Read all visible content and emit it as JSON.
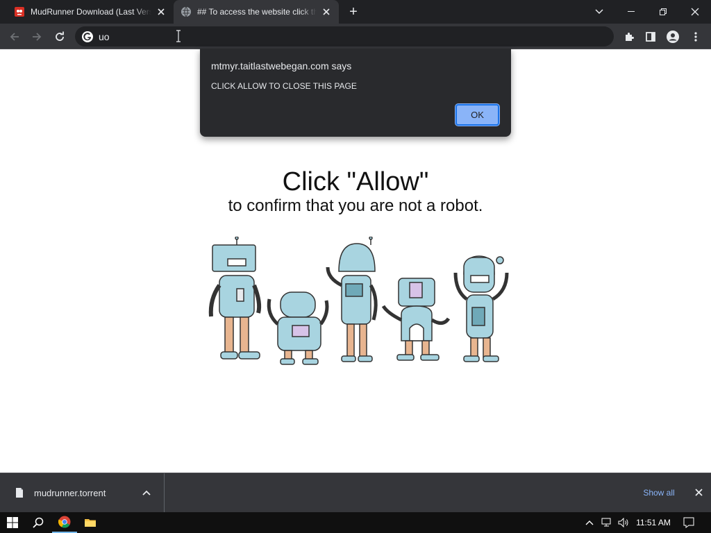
{
  "browser": {
    "tabs": [
      {
        "title": "MudRunner Download (Last Version",
        "favicon": "red-app-icon",
        "active": false
      },
      {
        "title": "## To access the website click the",
        "favicon": "globe-icon",
        "active": true
      }
    ],
    "new_tab_label": "+",
    "address_bar": {
      "value": "uo",
      "icon": "google-g-icon"
    }
  },
  "page": {
    "headline": "Click \"Allow\"",
    "subline": "to confirm that you are not a robot.",
    "image": "five-cartoon-robots"
  },
  "alert": {
    "origin": "mtmyr.taitlastwebegan.com says",
    "message": "CLICK ALLOW TO CLOSE THIS PAGE",
    "ok_label": "OK"
  },
  "download_shelf": {
    "file_name": "mudrunner.torrent",
    "show_all_label": "Show all"
  },
  "taskbar": {
    "time": "11:51 AM"
  },
  "colors": {
    "accent": "#8ab4f8",
    "robot_body": "#a8d4e0",
    "tab_bg": "#35363a",
    "frame_bg": "#202124"
  }
}
